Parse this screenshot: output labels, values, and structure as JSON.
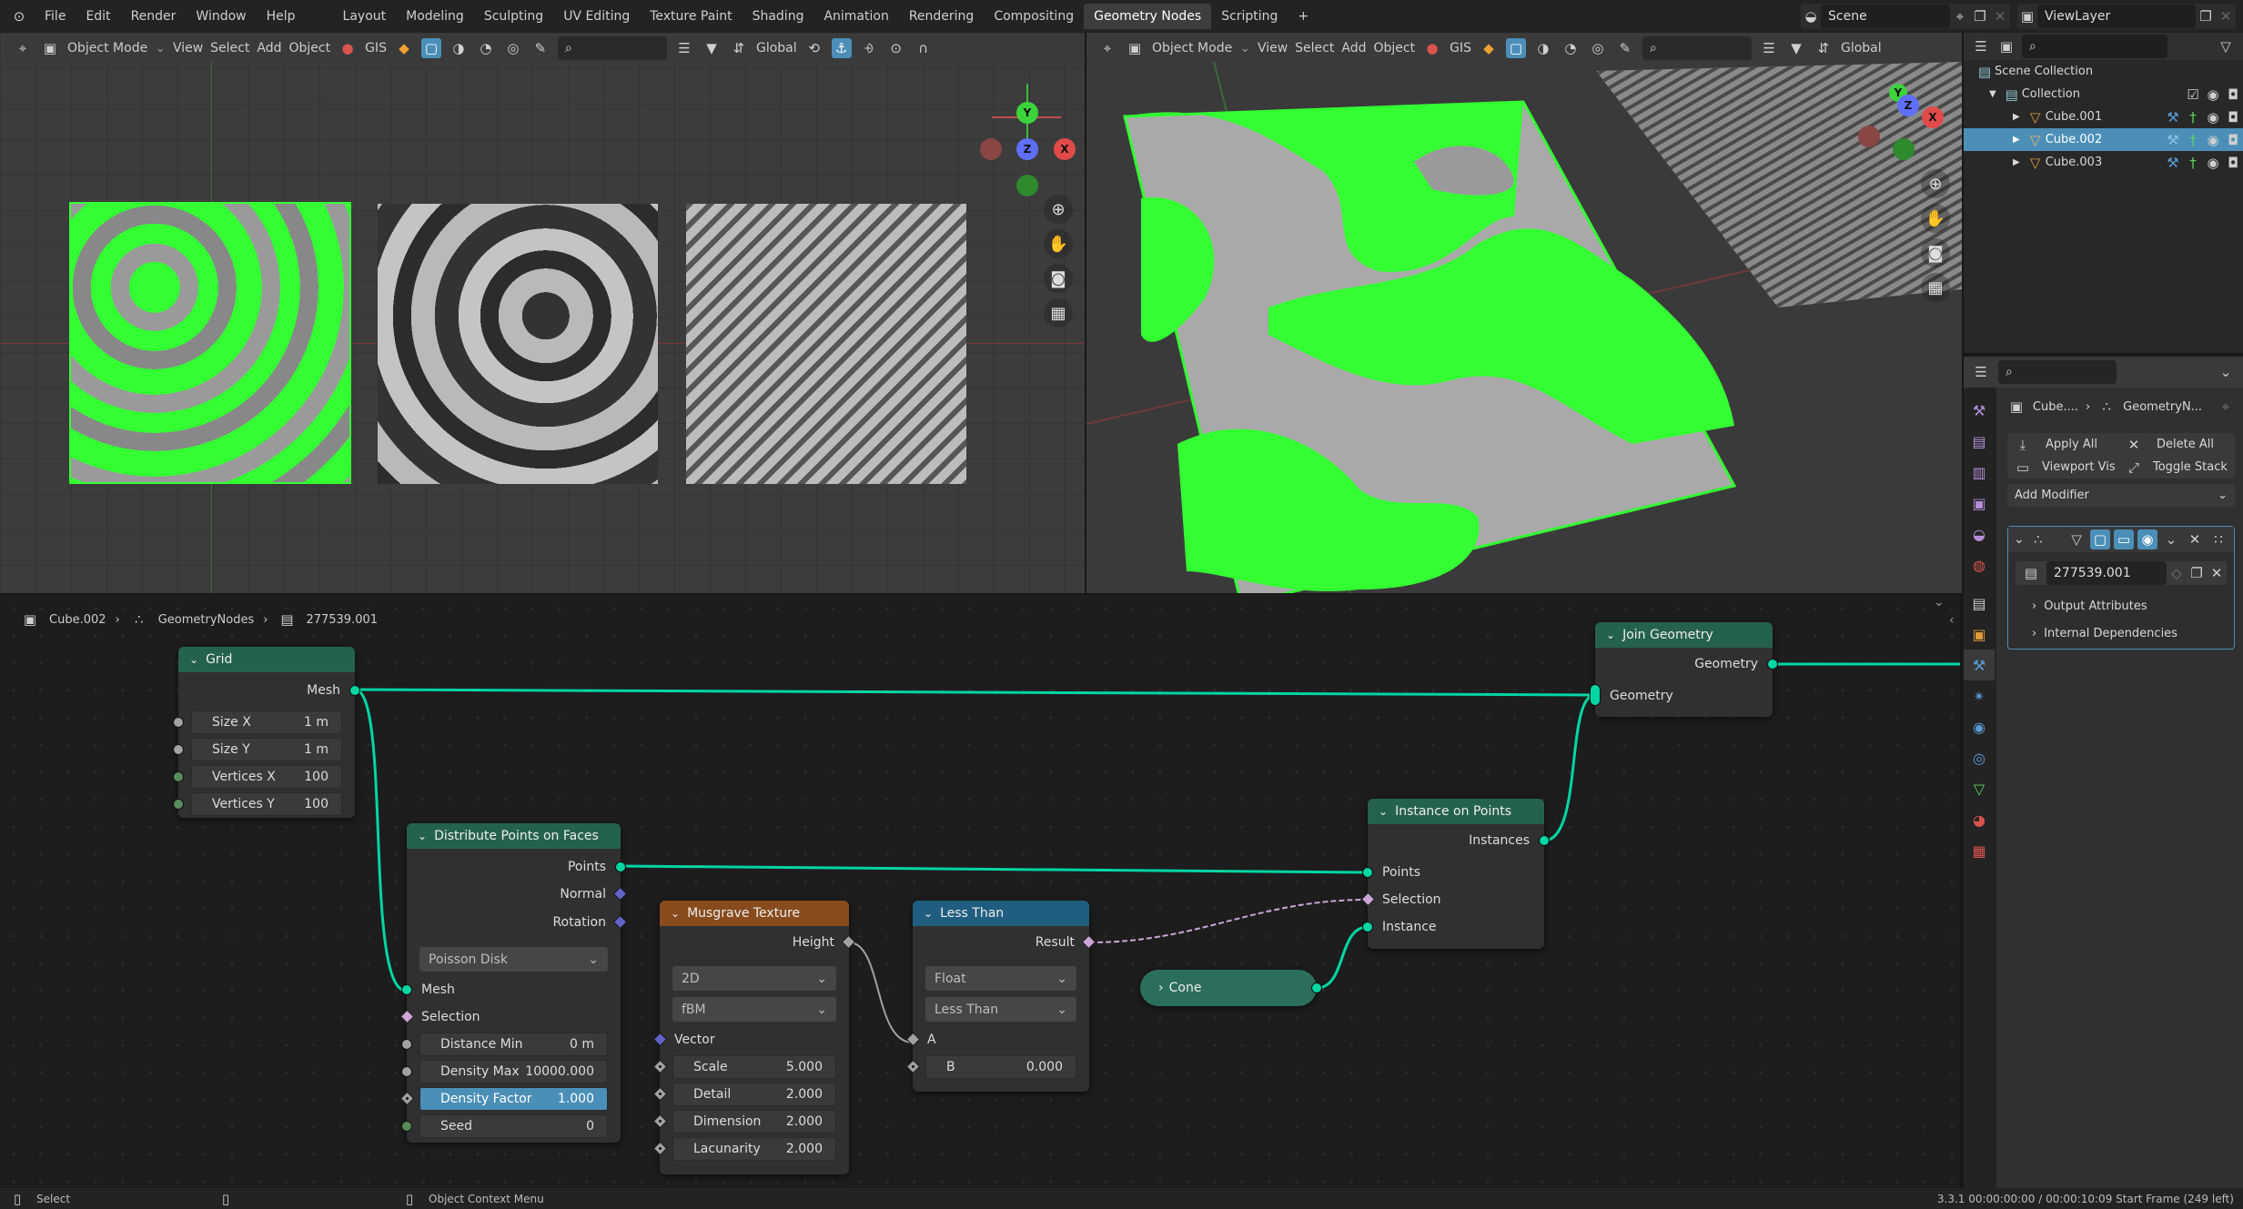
{
  "app": {
    "menus": [
      "File",
      "Edit",
      "Render",
      "Window",
      "Help"
    ]
  },
  "workspaces": {
    "tabs": [
      "Layout",
      "Modeling",
      "Sculpting",
      "UV Editing",
      "Texture Paint",
      "Shading",
      "Animation",
      "Rendering",
      "Compositing",
      "Geometry Nodes",
      "Scripting"
    ],
    "active": "Geometry Nodes",
    "add_label": "+"
  },
  "scene": {
    "name": "Scene",
    "view_layer": "ViewLayer"
  },
  "viewport_left": {
    "mode": "Object Mode",
    "menus": [
      "View",
      "Select",
      "Add",
      "Object"
    ],
    "gis": "GIS",
    "orientation": "Global",
    "gizmo": {
      "x": "X",
      "y": "Y",
      "z": "Z"
    }
  },
  "viewport_right": {
    "mode": "Object Mode",
    "menus": [
      "View",
      "Select",
      "Add",
      "Object"
    ],
    "gis": "GIS",
    "orientation": "Global",
    "gizmo": {
      "x": "X",
      "y": "Y",
      "z": "Z"
    }
  },
  "outliner": {
    "root": "Scene Collection",
    "collection": "Collection",
    "objects": [
      {
        "name": "Cube.001",
        "selected": false
      },
      {
        "name": "Cube.002",
        "selected": true
      },
      {
        "name": "Cube.003",
        "selected": false
      }
    ]
  },
  "properties": {
    "breadcrumb_object": "Cube....",
    "breadcrumb_modifier": "GeometryN...",
    "apply_all": "Apply All",
    "delete_all": "Delete All",
    "viewport_vis": "Viewport Vis",
    "toggle_stack": "Toggle Stack",
    "add_modifier": "Add Modifier",
    "node_group": "277539.001",
    "output_attributes": "Output Attributes",
    "internal_dependencies": "Internal Dependencies"
  },
  "node_editor": {
    "breadcrumb": [
      "Cube.002",
      "GeometryNodes",
      "277539.001"
    ],
    "nodes": {
      "grid": {
        "title": "Grid",
        "out_mesh": "Mesh",
        "inputs": [
          {
            "label": "Size X",
            "value": "1 m"
          },
          {
            "label": "Size Y",
            "value": "1 m"
          },
          {
            "label": "Vertices X",
            "value": "100"
          },
          {
            "label": "Vertices Y",
            "value": "100"
          }
        ]
      },
      "distribute": {
        "title": "Distribute Points on Faces",
        "outputs": [
          "Points",
          "Normal",
          "Rotation"
        ],
        "mode": "Poisson Disk",
        "in_mesh": "Mesh",
        "in_selection": "Selection",
        "inputs": [
          {
            "label": "Distance Min",
            "value": "0 m"
          },
          {
            "label": "Density Max",
            "value": "10000.000"
          },
          {
            "label": "Density Factor",
            "value": "1.000"
          },
          {
            "label": "Seed",
            "value": "0"
          }
        ]
      },
      "musgrave": {
        "title": "Musgrave Texture",
        "out_height": "Height",
        "dimensions": "2D",
        "type": "fBM",
        "in_vector": "Vector",
        "inputs": [
          {
            "label": "Scale",
            "value": "5.000"
          },
          {
            "label": "Detail",
            "value": "2.000"
          },
          {
            "label": "Dimension",
            "value": "2.000"
          },
          {
            "label": "Lacunarity",
            "value": "2.000"
          }
        ]
      },
      "less_than": {
        "title": "Less Than",
        "out_result": "Result",
        "data_type": "Float",
        "operation": "Less Than",
        "in_a": "A",
        "in_b_label": "B",
        "in_b_value": "0.000"
      },
      "cone": {
        "title": "Cone"
      },
      "instance_on_points": {
        "title": "Instance on Points",
        "out_instances": "Instances",
        "in_points": "Points",
        "in_selection": "Selection",
        "in_instance": "Instance"
      },
      "join_geometry": {
        "title": "Join Geometry",
        "out_geometry": "Geometry",
        "in_geometry": "Geometry"
      }
    }
  },
  "statusbar": {
    "left_click": "Select",
    "right_click": "Object Context Menu",
    "info": "3.3.1  00:00:00:00 / 00:00:10:09  Start Frame (249 left)"
  },
  "colors": {
    "geometry_socket": "#00d6a3",
    "selection_highlight": "#4a8fb7",
    "object_selected_green": "#33ff33",
    "geometry_node_header": "#25614f",
    "texture_node_header": "#874b1e",
    "converter_node_header": "#1f5e7f"
  }
}
